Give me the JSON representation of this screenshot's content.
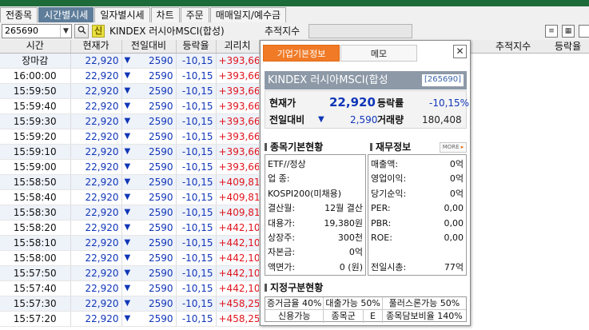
{
  "tabs": [
    "전종목",
    "시간별시세",
    "일자별시세",
    "차트",
    "주문",
    "매매일지/예수금"
  ],
  "toolbar": {
    "code": "265690",
    "new_badge": "신",
    "stock_name": "KINDEX 러시아MSCI(합성)",
    "track_label": "추적지수",
    "dropdown_icon": "chevron-down-icon",
    "search_icon": "search-icon"
  },
  "grid": {
    "headers": [
      "시간",
      "현재가",
      "전일대비",
      "등락율",
      "괴리치"
    ],
    "right_headers": [
      "추적지수",
      "등락율"
    ],
    "rows": [
      {
        "time": "장마감",
        "price": "22,920",
        "diff": "2590",
        "rate": "-10,15",
        "disp": "+393,66"
      },
      {
        "time": "16:00:00",
        "price": "22,920",
        "diff": "2590",
        "rate": "-10,15",
        "disp": "+393,66"
      },
      {
        "time": "15:59:50",
        "price": "22,920",
        "diff": "2590",
        "rate": "-10,15",
        "disp": "+393,66"
      },
      {
        "time": "15:59:40",
        "price": "22,920",
        "diff": "2590",
        "rate": "-10,15",
        "disp": "+393,66"
      },
      {
        "time": "15:59:30",
        "price": "22,920",
        "diff": "2590",
        "rate": "-10,15",
        "disp": "+393,66"
      },
      {
        "time": "15:59:20",
        "price": "22,920",
        "diff": "2590",
        "rate": "-10,15",
        "disp": "+393,66"
      },
      {
        "time": "15:59:10",
        "price": "22,920",
        "diff": "2590",
        "rate": "-10,15",
        "disp": "+393,66"
      },
      {
        "time": "15:59:00",
        "price": "22,920",
        "diff": "2590",
        "rate": "-10,15",
        "disp": "+393,66"
      },
      {
        "time": "15:58:50",
        "price": "22,920",
        "diff": "2590",
        "rate": "-10,15",
        "disp": "+409,81"
      },
      {
        "time": "15:58:40",
        "price": "22,920",
        "diff": "2590",
        "rate": "-10,15",
        "disp": "+409,81"
      },
      {
        "time": "15:58:30",
        "price": "22,920",
        "diff": "2590",
        "rate": "-10,15",
        "disp": "+409,81"
      },
      {
        "time": "15:58:20",
        "price": "22,920",
        "diff": "2590",
        "rate": "-10,15",
        "disp": "+442,10"
      },
      {
        "time": "15:58:10",
        "price": "22,920",
        "diff": "2590",
        "rate": "-10,15",
        "disp": "+442,10"
      },
      {
        "time": "15:58:00",
        "price": "22,920",
        "diff": "2590",
        "rate": "-10,15",
        "disp": "+442,10"
      },
      {
        "time": "15:57:50",
        "price": "22,920",
        "diff": "2590",
        "rate": "-10,15",
        "disp": "+442,10"
      },
      {
        "time": "15:57:40",
        "price": "22,920",
        "diff": "2590",
        "rate": "-10,15",
        "disp": "+442,10"
      },
      {
        "time": "15:57:30",
        "price": "22,920",
        "diff": "2590",
        "rate": "-10,15",
        "disp": "+458,25"
      },
      {
        "time": "15:57:20",
        "price": "22,920",
        "diff": "2590",
        "rate": "-10,15",
        "disp": "+458,25"
      }
    ],
    "down_arrow": "▼"
  },
  "popup": {
    "tab_info": "기업기본정보",
    "tab_memo": "메모",
    "close": "✕",
    "title": "KINDEX 러시아MSCI(합성",
    "code": "[265690]",
    "quote": {
      "price_label": "현재가",
      "price": "22,920",
      "rate_label": "등락률",
      "rate": "-10,15%",
      "diff_label": "전일대비",
      "diff_arrow": "▼",
      "diff": "2,590",
      "volume_label": "거래량",
      "volume": "180,408"
    },
    "basic": {
      "section": "종목기본현황",
      "rows": [
        {
          "label": "ETF//정상",
          "value": ""
        },
        {
          "label": "업  종:",
          "value": ""
        },
        {
          "label": "KOSPI200(미채용)",
          "value": ""
        },
        {
          "label": "결산월:",
          "value": "12월 결산"
        },
        {
          "label": "대용가:",
          "value": "19,380원"
        },
        {
          "label": "상장주:",
          "value": "300천"
        },
        {
          "label": "자본금:",
          "value": "0억"
        },
        {
          "label": "액면가:",
          "value": "0 (원)"
        }
      ]
    },
    "finance": {
      "section": "재무정보",
      "more": "MORE",
      "rows": [
        {
          "label": "매출액:",
          "value": "0억"
        },
        {
          "label": "영업이익:",
          "value": "0억"
        },
        {
          "label": "당기순익:",
          "value": "0억"
        },
        {
          "label": "PER:",
          "value": "0,00"
        },
        {
          "label": "PBR:",
          "value": "0,00"
        },
        {
          "label": "ROE:",
          "value": "0,00"
        },
        {
          "label": "",
          "value": ""
        },
        {
          "label": "전일시총:",
          "value": "77억"
        }
      ]
    },
    "designation": {
      "section": "지정구분현황",
      "row1": [
        "증거금율 40%",
        "대출가능 50%",
        "풀러스론가능 50%"
      ],
      "row2": [
        "신용가능",
        "종목군",
        "E",
        "종목담보비율 140%"
      ]
    }
  },
  "colors": {
    "active_tab": "#5e7d9a",
    "popup_tab": "#f07a26",
    "down": "#1036b8",
    "up": "#e0141c"
  }
}
